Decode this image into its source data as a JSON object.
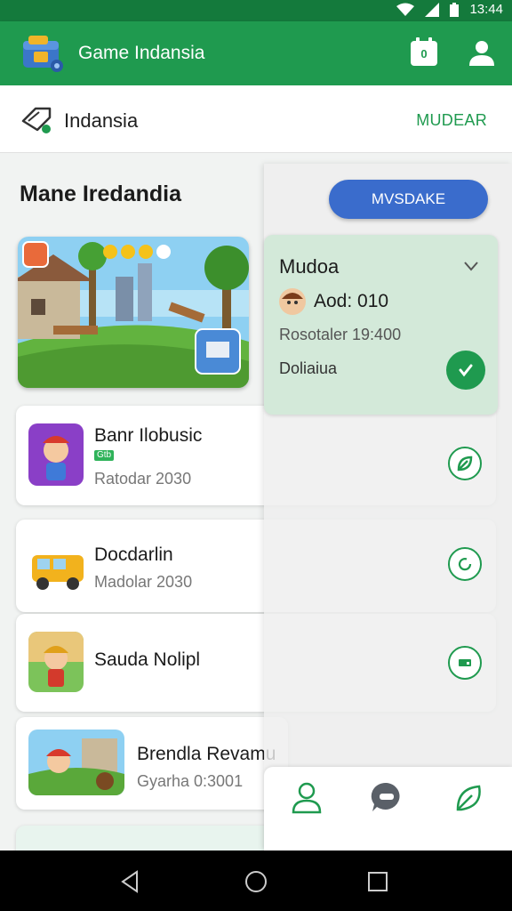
{
  "status_bar": {
    "time": "13:44"
  },
  "app_bar": {
    "title": "Game Indansia",
    "badge_count": "0"
  },
  "sub_header": {
    "title": "Indansia",
    "action": "MUDEAR"
  },
  "main": {
    "section_title": "Mane Iredandia"
  },
  "games": [
    {
      "name": "Banr Ilobusic",
      "tag": "Gtb",
      "meta": "Ratodar 2030"
    },
    {
      "name": "Docdarlin",
      "meta": "Madolar 2030"
    },
    {
      "name": "Sauda Nolipl"
    },
    {
      "name": "Brendla Revamu",
      "meta": "Gyarha 0:3001"
    }
  ],
  "panel": {
    "button_label": "MVSDAKE",
    "detail": {
      "title": "Mudoa",
      "meta": "Aod: 010",
      "meta2": "Rosotaler 19:400",
      "meta3": "Doliaiua"
    }
  },
  "colors": {
    "primary": "#1f9a4f",
    "status": "#147a3c",
    "accent_button": "#3a6ccc",
    "detail_bg": "#d3e9d9"
  },
  "icons": [
    "wifi-icon",
    "signal-icon",
    "battery-icon",
    "app-logo-icon",
    "calendar-badge-icon",
    "account-icon",
    "tag-icon",
    "chevron-down-icon",
    "check-icon",
    "person-icon",
    "chat-icon",
    "leaf-icon",
    "back-icon",
    "home-icon",
    "recents-icon"
  ]
}
